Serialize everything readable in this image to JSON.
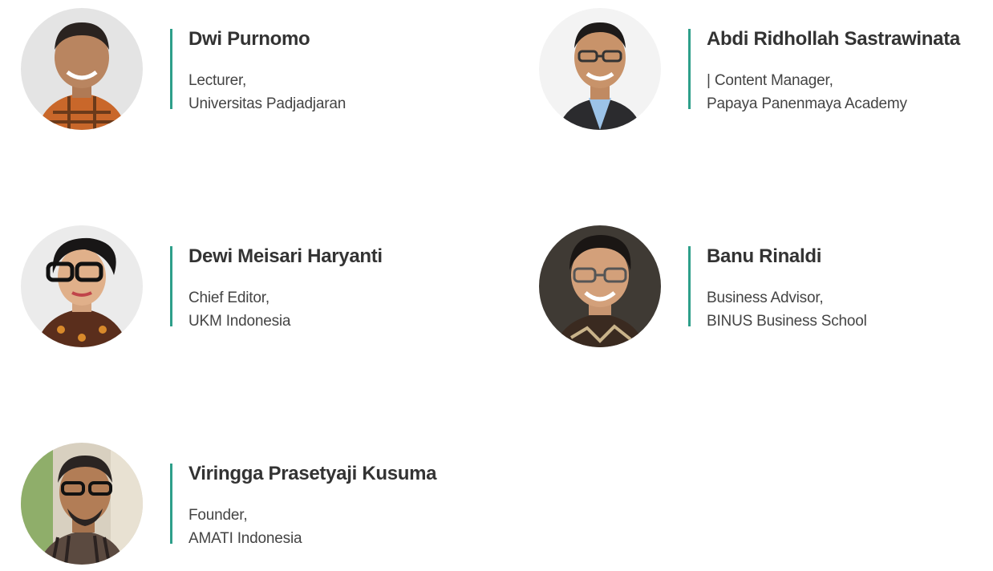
{
  "speakers": [
    {
      "name": "Dwi Purnomo",
      "role": "Lecturer,",
      "organization": "Universitas Padjadjaran",
      "photo_icon": "person-photo-icon"
    },
    {
      "name": "Abdi Ridhollah Sastrawinata",
      "role": "| Content Manager,",
      "organization": "Papaya Panenmaya Academy",
      "photo_icon": "person-photo-icon"
    },
    {
      "name": "Dewi Meisari Haryanti",
      "role": "Chief Editor,",
      "organization": "UKM Indonesia",
      "photo_icon": "person-photo-icon"
    },
    {
      "name": "Banu Rinaldi",
      "role": "Business Advisor,",
      "organization": "BINUS Business School",
      "photo_icon": "person-photo-icon"
    },
    {
      "name": "Viringga Prasetyaji Kusuma",
      "role": "Founder,",
      "organization": "AMATI Indonesia",
      "photo_icon": "person-photo-icon"
    }
  ],
  "colors": {
    "accent_line": "#2e9f8a",
    "name_text": "#333333",
    "detail_text": "#444444"
  }
}
